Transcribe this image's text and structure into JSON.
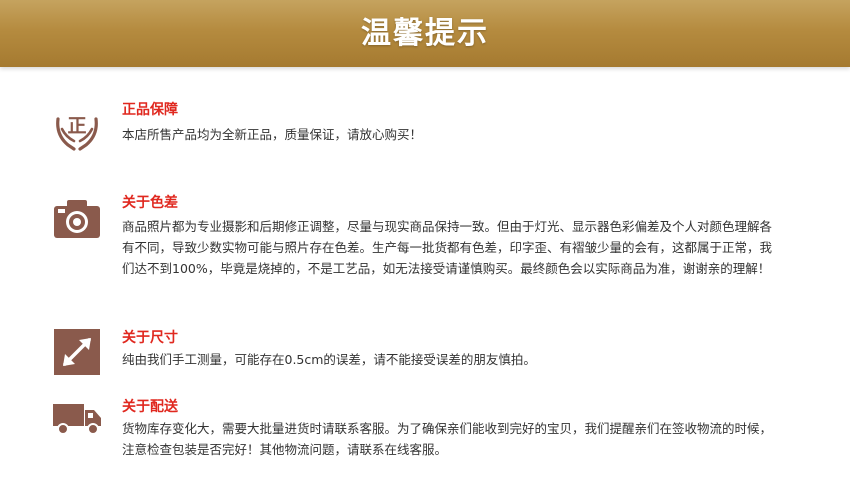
{
  "banner": {
    "title": "温馨提示"
  },
  "sections": [
    {
      "icon": "genuine-hands-icon",
      "title": "正品保障",
      "body": "本店所售产品均为全新正品，质量保证，请放心购买！",
      "icon_char": "正"
    },
    {
      "icon": "camera-icon",
      "title": "关于色差",
      "body": "商品照片都为专业摄影和后期修正调整，尽量与现实商品保持一致。但由于灯光、显示器色彩偏差及个人对颜色理解各有不同，导致少数实物可能与照片存在色差。生产每一批货都有色差，印字歪、有褶皱少量的会有，这都属于正常，我们达不到100%，毕竟是烧掉的，不是工艺品，如无法接受请谨慎购买。最终颜色会以实际商品为准，谢谢亲的理解！"
    },
    {
      "icon": "resize-arrow-icon",
      "title": "关于尺寸",
      "body": "纯由我们手工测量，可能存在0.5cm的误差，请不能接受误差的朋友慎拍。"
    },
    {
      "icon": "delivery-truck-icon",
      "title": "关于配送",
      "body": "货物库存变化大，需要大批量进货时请联系客服。为了确保亲们能收到完好的宝贝，我们提醒亲们在签收物流的时候，注意检查包装是否完好！其他物流问题，请联系在线客服。"
    }
  ],
  "colors": {
    "accent_red": "#e0281f",
    "icon_brown": "#8a5a4c",
    "banner_gold": "#b58b3f"
  }
}
